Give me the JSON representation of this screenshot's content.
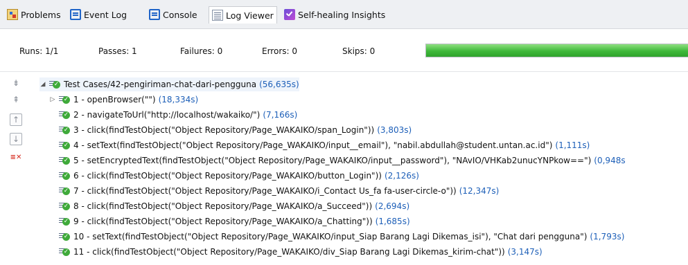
{
  "tabs": [
    {
      "label": "Problems",
      "icon": "problems-icon"
    },
    {
      "label": "Event Log",
      "icon": "event-log-icon"
    },
    {
      "label": "Console",
      "icon": "console-icon"
    },
    {
      "label": "Log Viewer",
      "icon": "log-viewer-icon",
      "active": true
    },
    {
      "label": "Self-healing Insights",
      "icon": "self-healing-icon"
    }
  ],
  "summary": {
    "runs": "Runs: 1/1",
    "passes": "Passes: 1",
    "failures": "Failures: 0",
    "errors": "Errors: 0",
    "skips": "Skips: 0",
    "progress_fraction": 1.0,
    "progress_color": "#3fb83a"
  },
  "side_toolbar": [
    {
      "icon": "collapse-all-icon",
      "glyph": "⇟"
    },
    {
      "icon": "expand-all-icon",
      "glyph": "⇞"
    },
    {
      "icon": "previous-failure-icon",
      "glyph": "↑"
    },
    {
      "icon": "next-failure-icon",
      "glyph": "↓"
    },
    {
      "icon": "show-failures-only-icon",
      "glyph": "≡✕"
    }
  ],
  "tree": {
    "root": {
      "text": "Test Cases/42-pengiriman-chat-dari-pengguna",
      "duration": "(56,635s)",
      "status_icon": "passed-icon"
    },
    "steps": [
      {
        "text": "1 - openBrowser(\"\")",
        "duration": "(18,334s)",
        "expandable": true
      },
      {
        "text": "2 - navigateToUrl(\"http://localhost/wakaiko/\")",
        "duration": "(7,166s)"
      },
      {
        "text": "3 - click(findTestObject(\"Object Repository/Page_WAKAIKO/span_Login\"))",
        "duration": "(3,803s)"
      },
      {
        "text": "4 - setText(findTestObject(\"Object Repository/Page_WAKAIKO/input__email\"), \"nabil.abdullah@student.untan.ac.id\")",
        "duration": "(1,111s)"
      },
      {
        "text": "5 - setEncryptedText(findTestObject(\"Object Repository/Page_WAKAIKO/input__password\"), \"NAvIO/VHKab2unucYNPkow==\")",
        "duration": "(0,948s"
      },
      {
        "text": "6 - click(findTestObject(\"Object Repository/Page_WAKAIKO/button_Login\"))",
        "duration": "(2,126s)"
      },
      {
        "text": "7 - click(findTestObject(\"Object Repository/Page_WAKAIKO/i_Contact Us_fa fa-user-circle-o\"))",
        "duration": "(12,347s)"
      },
      {
        "text": "8 - click(findTestObject(\"Object Repository/Page_WAKAIKO/a_Succeed\"))",
        "duration": "(2,694s)"
      },
      {
        "text": "9 - click(findTestObject(\"Object Repository/Page_WAKAIKO/a_Chatting\"))",
        "duration": "(1,685s)"
      },
      {
        "text": "10 - setText(findTestObject(\"Object Repository/Page_WAKAIKO/input_Siap Barang Lagi Dikemas_isi\"), \"Chat dari pengguna\")",
        "duration": "(1,793s)"
      },
      {
        "text": "11 - click(findTestObject(\"Object Repository/Page_WAKAIKO/div_Siap Barang Lagi Dikemas_kirim-chat\"))",
        "duration": "(3,147s)"
      }
    ]
  }
}
